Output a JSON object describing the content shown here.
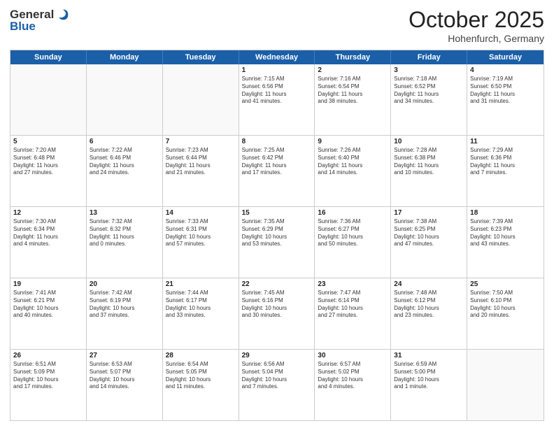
{
  "header": {
    "logo_general": "General",
    "logo_blue": "Blue",
    "title_month": "October 2025",
    "title_location": "Hohenfurch, Germany"
  },
  "weekdays": [
    "Sunday",
    "Monday",
    "Tuesday",
    "Wednesday",
    "Thursday",
    "Friday",
    "Saturday"
  ],
  "rows": [
    [
      {
        "day": "",
        "info": ""
      },
      {
        "day": "",
        "info": ""
      },
      {
        "day": "",
        "info": ""
      },
      {
        "day": "1",
        "info": "Sunrise: 7:15 AM\nSunset: 6:56 PM\nDaylight: 11 hours\nand 41 minutes."
      },
      {
        "day": "2",
        "info": "Sunrise: 7:16 AM\nSunset: 6:54 PM\nDaylight: 11 hours\nand 38 minutes."
      },
      {
        "day": "3",
        "info": "Sunrise: 7:18 AM\nSunset: 6:52 PM\nDaylight: 11 hours\nand 34 minutes."
      },
      {
        "day": "4",
        "info": "Sunrise: 7:19 AM\nSunset: 6:50 PM\nDaylight: 11 hours\nand 31 minutes."
      }
    ],
    [
      {
        "day": "5",
        "info": "Sunrise: 7:20 AM\nSunset: 6:48 PM\nDaylight: 11 hours\nand 27 minutes."
      },
      {
        "day": "6",
        "info": "Sunrise: 7:22 AM\nSunset: 6:46 PM\nDaylight: 11 hours\nand 24 minutes."
      },
      {
        "day": "7",
        "info": "Sunrise: 7:23 AM\nSunset: 6:44 PM\nDaylight: 11 hours\nand 21 minutes."
      },
      {
        "day": "8",
        "info": "Sunrise: 7:25 AM\nSunset: 6:42 PM\nDaylight: 11 hours\nand 17 minutes."
      },
      {
        "day": "9",
        "info": "Sunrise: 7:26 AM\nSunset: 6:40 PM\nDaylight: 11 hours\nand 14 minutes."
      },
      {
        "day": "10",
        "info": "Sunrise: 7:28 AM\nSunset: 6:38 PM\nDaylight: 11 hours\nand 10 minutes."
      },
      {
        "day": "11",
        "info": "Sunrise: 7:29 AM\nSunset: 6:36 PM\nDaylight: 11 hours\nand 7 minutes."
      }
    ],
    [
      {
        "day": "12",
        "info": "Sunrise: 7:30 AM\nSunset: 6:34 PM\nDaylight: 11 hours\nand 4 minutes."
      },
      {
        "day": "13",
        "info": "Sunrise: 7:32 AM\nSunset: 6:32 PM\nDaylight: 11 hours\nand 0 minutes."
      },
      {
        "day": "14",
        "info": "Sunrise: 7:33 AM\nSunset: 6:31 PM\nDaylight: 10 hours\nand 57 minutes."
      },
      {
        "day": "15",
        "info": "Sunrise: 7:35 AM\nSunset: 6:29 PM\nDaylight: 10 hours\nand 53 minutes."
      },
      {
        "day": "16",
        "info": "Sunrise: 7:36 AM\nSunset: 6:27 PM\nDaylight: 10 hours\nand 50 minutes."
      },
      {
        "day": "17",
        "info": "Sunrise: 7:38 AM\nSunset: 6:25 PM\nDaylight: 10 hours\nand 47 minutes."
      },
      {
        "day": "18",
        "info": "Sunrise: 7:39 AM\nSunset: 6:23 PM\nDaylight: 10 hours\nand 43 minutes."
      }
    ],
    [
      {
        "day": "19",
        "info": "Sunrise: 7:41 AM\nSunset: 6:21 PM\nDaylight: 10 hours\nand 40 minutes."
      },
      {
        "day": "20",
        "info": "Sunrise: 7:42 AM\nSunset: 6:19 PM\nDaylight: 10 hours\nand 37 minutes."
      },
      {
        "day": "21",
        "info": "Sunrise: 7:44 AM\nSunset: 6:17 PM\nDaylight: 10 hours\nand 33 minutes."
      },
      {
        "day": "22",
        "info": "Sunrise: 7:45 AM\nSunset: 6:16 PM\nDaylight: 10 hours\nand 30 minutes."
      },
      {
        "day": "23",
        "info": "Sunrise: 7:47 AM\nSunset: 6:14 PM\nDaylight: 10 hours\nand 27 minutes."
      },
      {
        "day": "24",
        "info": "Sunrise: 7:48 AM\nSunset: 6:12 PM\nDaylight: 10 hours\nand 23 minutes."
      },
      {
        "day": "25",
        "info": "Sunrise: 7:50 AM\nSunset: 6:10 PM\nDaylight: 10 hours\nand 20 minutes."
      }
    ],
    [
      {
        "day": "26",
        "info": "Sunrise: 6:51 AM\nSunset: 5:09 PM\nDaylight: 10 hours\nand 17 minutes."
      },
      {
        "day": "27",
        "info": "Sunrise: 6:53 AM\nSunset: 5:07 PM\nDaylight: 10 hours\nand 14 minutes."
      },
      {
        "day": "28",
        "info": "Sunrise: 6:54 AM\nSunset: 5:05 PM\nDaylight: 10 hours\nand 11 minutes."
      },
      {
        "day": "29",
        "info": "Sunrise: 6:56 AM\nSunset: 5:04 PM\nDaylight: 10 hours\nand 7 minutes."
      },
      {
        "day": "30",
        "info": "Sunrise: 6:57 AM\nSunset: 5:02 PM\nDaylight: 10 hours\nand 4 minutes."
      },
      {
        "day": "31",
        "info": "Sunrise: 6:59 AM\nSunset: 5:00 PM\nDaylight: 10 hours\nand 1 minute."
      },
      {
        "day": "",
        "info": ""
      }
    ]
  ]
}
